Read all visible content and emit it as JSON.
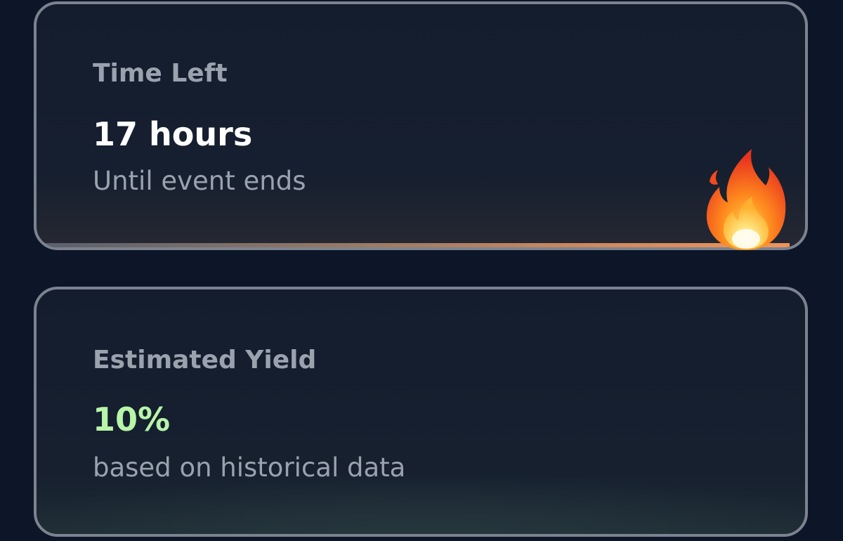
{
  "time_card": {
    "label": "Time Left",
    "value": "17 hours",
    "sub": "Until event ends",
    "progress_percent": 98,
    "icon": "fire-icon"
  },
  "yield_card": {
    "label": "Estimated Yield",
    "value": "10%",
    "sub": "based on historical data",
    "value_color": "#b7f5a8"
  },
  "colors": {
    "background": "#0c1628",
    "card": "#141d2e",
    "border": "#7c838f",
    "muted_text": "#9aa2ae",
    "progress_accent": "#f0935a"
  }
}
